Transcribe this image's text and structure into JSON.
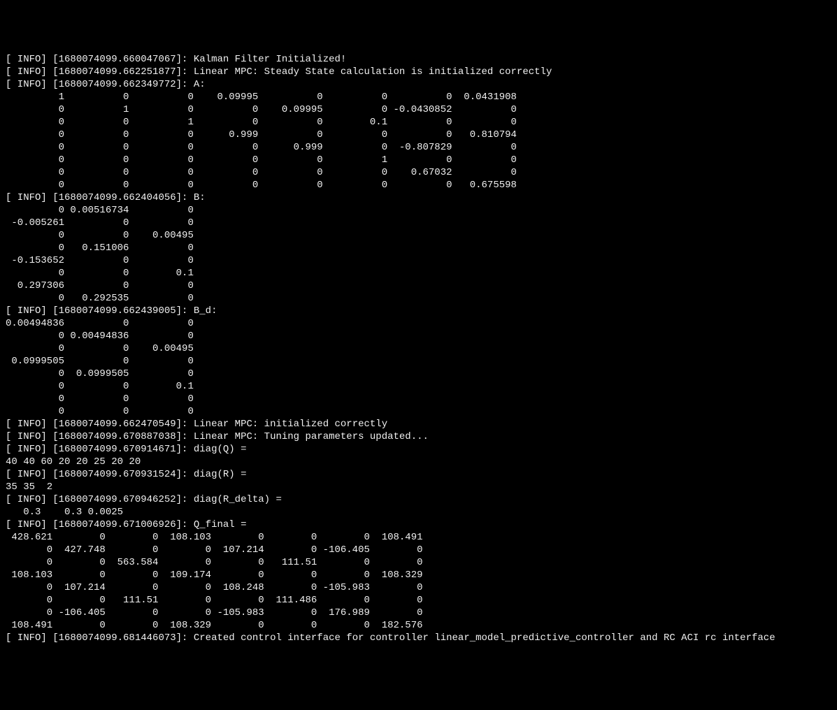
{
  "log": {
    "kalman": {
      "level": "[ INFO]",
      "ts": "[1680074099.660047067]:",
      "msg": "Kalman Filter Initialized!"
    },
    "mpc_steady": {
      "level": "[ INFO]",
      "ts": "[1680074099.662251877]:",
      "msg": "Linear MPC: Steady State calculation is initialized correctly"
    },
    "A": {
      "level": "[ INFO]",
      "ts": "[1680074099.662349772]:",
      "msg": "A:",
      "rows": [
        "         1          0          0    0.09995          0          0          0  0.0431908",
        "         0          1          0          0    0.09995          0 -0.0430852          0",
        "         0          0          1          0          0        0.1          0          0",
        "         0          0          0      0.999          0          0          0   0.810794",
        "         0          0          0          0      0.999          0  -0.807829          0",
        "         0          0          0          0          0          1          0          0",
        "         0          0          0          0          0          0    0.67032          0",
        "         0          0          0          0          0          0          0   0.675598"
      ]
    },
    "B": {
      "level": "[ INFO]",
      "ts": "[1680074099.662404056]:",
      "msg": "B:",
      "rows": [
        "         0 0.00516734          0",
        " -0.005261          0          0",
        "         0          0    0.00495",
        "         0   0.151006          0",
        " -0.153652          0          0",
        "         0          0        0.1",
        "  0.297306          0          0",
        "         0   0.292535          0"
      ]
    },
    "Bd": {
      "level": "[ INFO]",
      "ts": "[1680074099.662439005]:",
      "msg": "B_d:",
      "rows": [
        "0.00494836          0          0",
        "         0 0.00494836          0",
        "         0          0    0.00495",
        " 0.0999505          0          0",
        "         0  0.0999505          0",
        "         0          0        0.1",
        "         0          0          0",
        "         0          0          0"
      ]
    },
    "mpc_init": {
      "level": "[ INFO]",
      "ts": "[1680074099.662470549]:",
      "msg": "Linear MPC: initialized correctly"
    },
    "mpc_tuning": {
      "level": "[ INFO]",
      "ts": "[1680074099.670887038]:",
      "msg": "Linear MPC: Tuning parameters updated..."
    },
    "Q": {
      "level": "[ INFO]",
      "ts": "[1680074099.670914671]:",
      "msg": "diag(Q) =",
      "values": "40 40 60 20 20 25 20 20"
    },
    "R": {
      "level": "[ INFO]",
      "ts": "[1680074099.670931524]:",
      "msg": "diag(R) =",
      "values": "35 35  2"
    },
    "Rdelta": {
      "level": "[ INFO]",
      "ts": "[1680074099.670946252]:",
      "msg": "diag(R_delta) =",
      "values": "   0.3    0.3 0.0025"
    },
    "Qfinal": {
      "level": "[ INFO]",
      "ts": "[1680074099.671006926]:",
      "msg": "Q_final =",
      "rows": [
        " 428.621        0        0  108.103        0        0        0  108.491",
        "       0  427.748        0        0  107.214        0 -106.405        0",
        "       0        0  563.584        0        0   111.51        0        0",
        " 108.103        0        0  109.174        0        0        0  108.329",
        "       0  107.214        0        0  108.248        0 -105.983        0",
        "       0        0   111.51        0        0  111.486        0        0",
        "       0 -106.405        0        0 -105.983        0  176.989        0",
        " 108.491        0        0  108.329        0        0        0  182.576"
      ]
    },
    "interface": {
      "level": "[ INFO]",
      "ts": "[1680074099.681446073]:",
      "msg": "Created control interface for controller linear_model_predictive_controller and RC ACI rc interface"
    }
  }
}
